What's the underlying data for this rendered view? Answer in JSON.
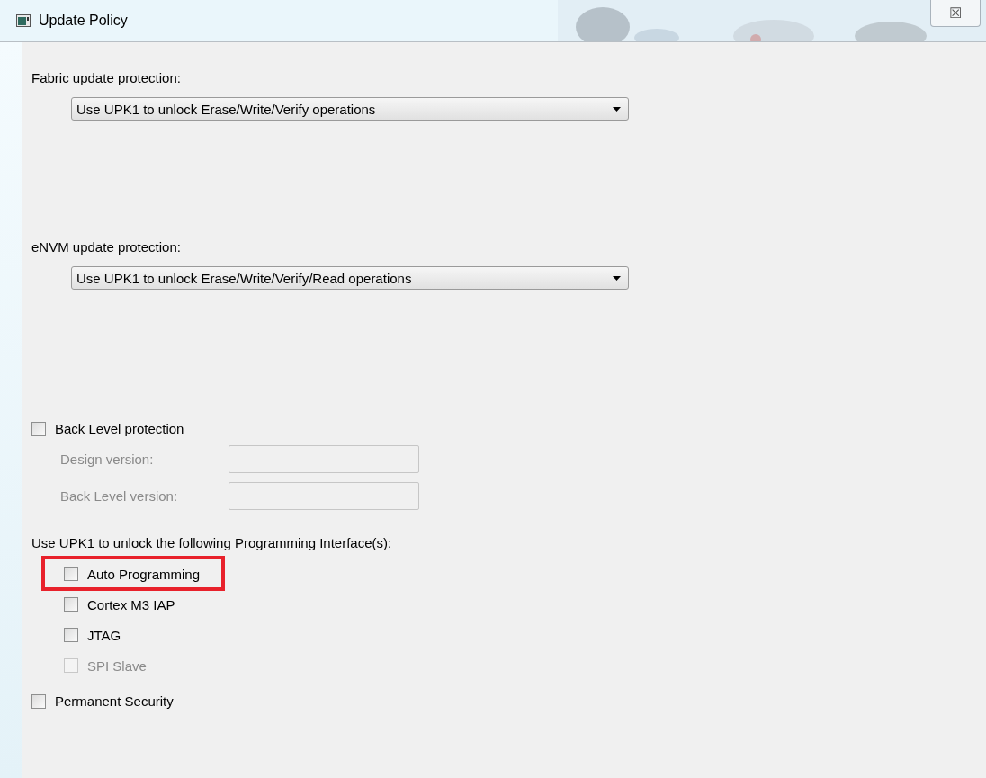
{
  "window": {
    "title": "Update Policy",
    "close_label": "☒"
  },
  "fabric": {
    "label": "Fabric update protection:",
    "value": "Use UPK1 to unlock Erase/Write/Verify operations"
  },
  "envm": {
    "label": "eNVM update protection:",
    "value": "Use UPK1 to unlock Erase/Write/Verify/Read operations"
  },
  "back_level": {
    "label": "Back Level protection",
    "checked": false,
    "fields": [
      {
        "label": "Design version:",
        "disabled": true
      },
      {
        "label": "Back Level version:",
        "disabled": true
      }
    ]
  },
  "interfaces": {
    "label": "Use UPK1 to unlock the following Programming Interface(s):",
    "items": [
      {
        "label": "Auto Programming",
        "checked": false,
        "disabled": false,
        "highlighted": true
      },
      {
        "label": "Cortex M3 IAP",
        "checked": false,
        "disabled": false,
        "highlighted": false
      },
      {
        "label": "JTAG",
        "checked": false,
        "disabled": false,
        "highlighted": false
      },
      {
        "label": "SPI Slave",
        "checked": false,
        "disabled": true,
        "highlighted": false
      }
    ]
  },
  "permanent": {
    "label": "Permanent Security",
    "checked": false
  }
}
